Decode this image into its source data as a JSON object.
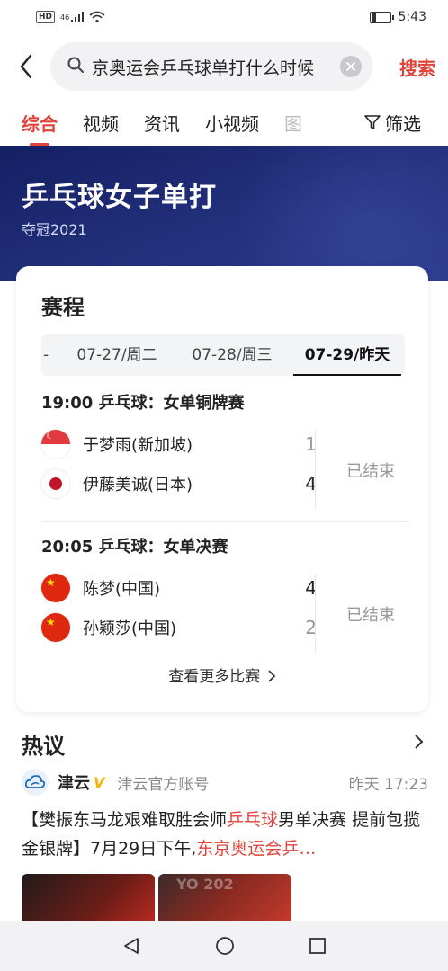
{
  "status_bar": {
    "hd": "HD",
    "network": "46",
    "time": "5:43"
  },
  "search": {
    "query": "京奥运会乒乓球单打什么时候",
    "button": "搜索"
  },
  "tabs": [
    {
      "label": "综合"
    },
    {
      "label": "视频"
    },
    {
      "label": "资讯"
    },
    {
      "label": "小视频"
    },
    {
      "label": "图"
    }
  ],
  "filter_label": "筛选",
  "banner": {
    "title": "乒乓球女子单打",
    "subtitle": "夺冠2021"
  },
  "schedule": {
    "title": "赛程",
    "dates_lead": "-",
    "dates": [
      "07-27/周二",
      "07-28/周三",
      "07-29/昨天"
    ],
    "matches": [
      {
        "title": "19:00 乒乓球：女单铜牌赛",
        "status": "已结束",
        "players": [
          {
            "name": "于梦雨(新加坡)",
            "score": "1",
            "flag": "sg"
          },
          {
            "name": "伊藤美诚(日本)",
            "score": "4",
            "flag": "jp"
          }
        ]
      },
      {
        "title": "20:05 乒乓球：女单决赛",
        "status": "已结束",
        "players": [
          {
            "name": "陈梦(中国)",
            "score": "4",
            "flag": "cn"
          },
          {
            "name": "孙颖莎(中国)",
            "score": "2",
            "flag": "cn"
          }
        ]
      }
    ],
    "more": "查看更多比赛"
  },
  "discussion": {
    "title": "热议",
    "author": "津云",
    "verified": "V",
    "account": "津云官方账号",
    "time": "昨天 17:23",
    "post_a": "【樊振东马龙艰难取胜会师",
    "post_hl1": "乒乓球",
    "post_b": "男单决赛 提前包揽金银牌】7月29日下午,",
    "post_hl2": "东京奥运会乒…"
  },
  "colors": {
    "accent": "#e0433a",
    "banner": "#1b2a6b"
  }
}
